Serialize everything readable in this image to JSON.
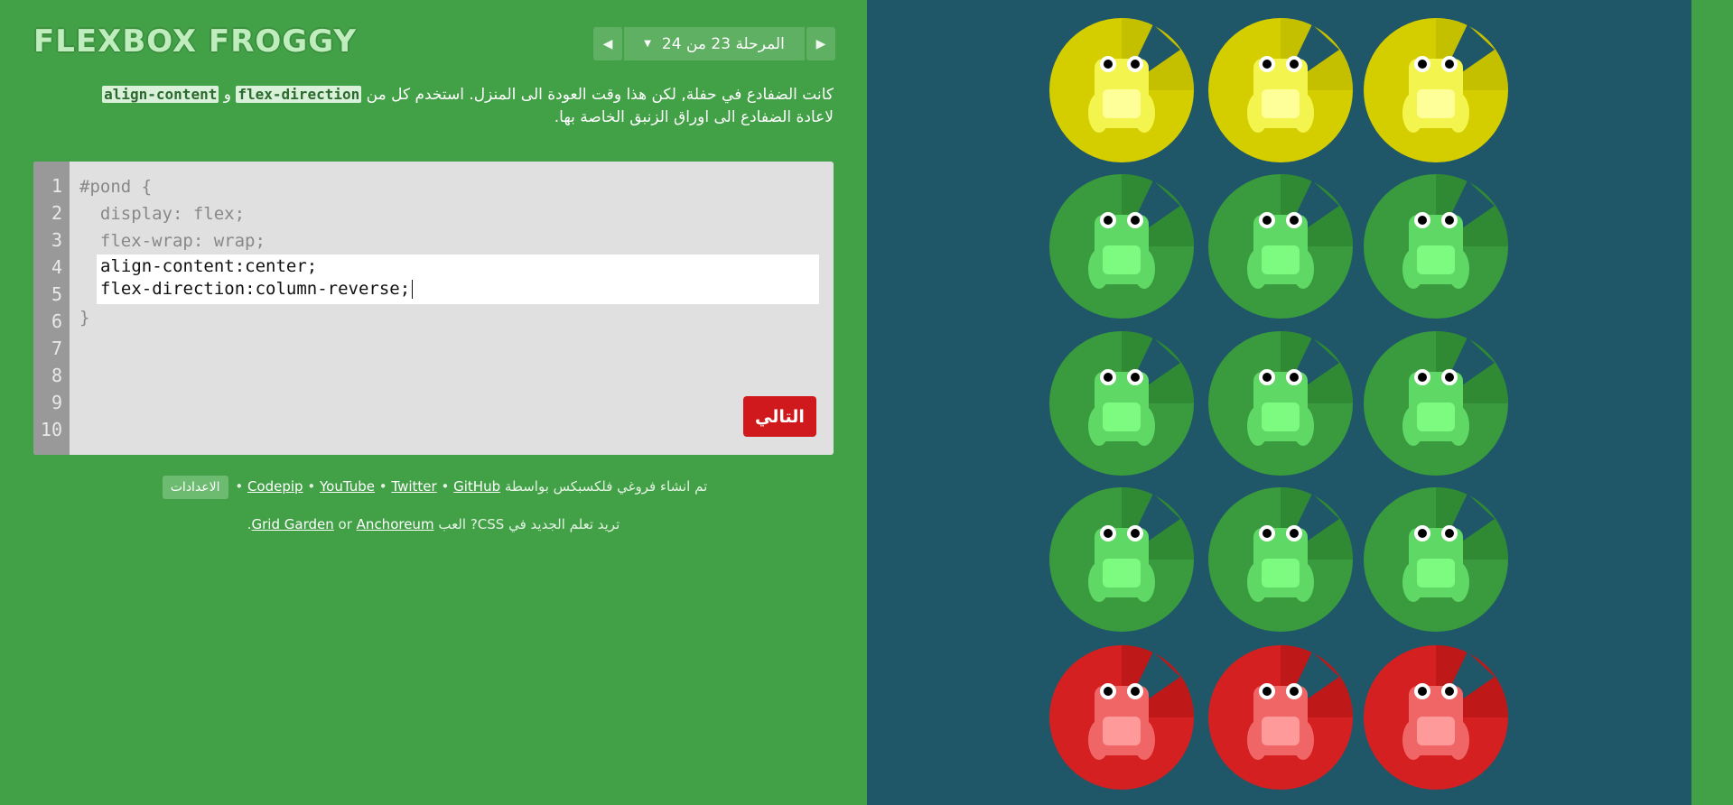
{
  "app": {
    "title": "FLEXBOX FROGGY"
  },
  "level": {
    "prev_icon": "triangle-left-icon",
    "next_icon": "triangle-right-icon",
    "label": "المرحلة",
    "current": "23",
    "of": "من",
    "total": "24",
    "caret": "▼"
  },
  "instructions": {
    "part1": "كانت الضفادع في حفلة, لكن هذا وقت العودة الى المنزل. استخدم كل من",
    "code1": "flex-direction",
    "and": "و",
    "code2": "align-content",
    "part2": "لاعادة الضفادع الى اوراق الزنبق الخاصة بها."
  },
  "editor": {
    "line_numbers": [
      "1",
      "2",
      "3",
      "4",
      "5",
      "6",
      "7",
      "8",
      "9",
      "10"
    ],
    "line1": "#pond {",
    "line2": "  display: flex;",
    "line3": "  flex-wrap: wrap;",
    "input_line1": "align-content:center;",
    "input_line2": "flex-direction:column-reverse;",
    "line6": "}",
    "next_button": "التالي"
  },
  "credits": {
    "prefix": "تم انشاء فروغي فلكسبكس بواسطة",
    "codepip": "Codepip",
    "youtube": "YouTube",
    "twitter": "Twitter",
    "github": "GitHub",
    "separator": "•",
    "settings": "الاعدادات"
  },
  "promo": {
    "text1": "تريد تعلم الجديد في CSS? العب",
    "grid_garden": "Grid Garden",
    "or": "or",
    "anchoreum": "Anchoreum",
    "period": "."
  },
  "board": {
    "rows": [
      [
        "yellow",
        "yellow",
        "yellow"
      ],
      [
        "green",
        "green",
        "green"
      ],
      [
        "green",
        "green",
        "green"
      ],
      [
        "green",
        "green",
        "green"
      ],
      [
        "red",
        "red",
        "red"
      ]
    ],
    "colors": {
      "yellow": {
        "pad": "#d4ce00",
        "padDark": "#c4c000",
        "frog": "#f4f44e",
        "frogLight": "#ffff99"
      },
      "green": {
        "pad": "#3a9a3e",
        "padDark": "#2f8a33",
        "frog": "#5fd865",
        "frogLight": "#7dfa80"
      },
      "red": {
        "pad": "#d42020",
        "padDark": "#bf1818",
        "frog": "#f06565",
        "frogLight": "#ff9a9a"
      }
    }
  }
}
